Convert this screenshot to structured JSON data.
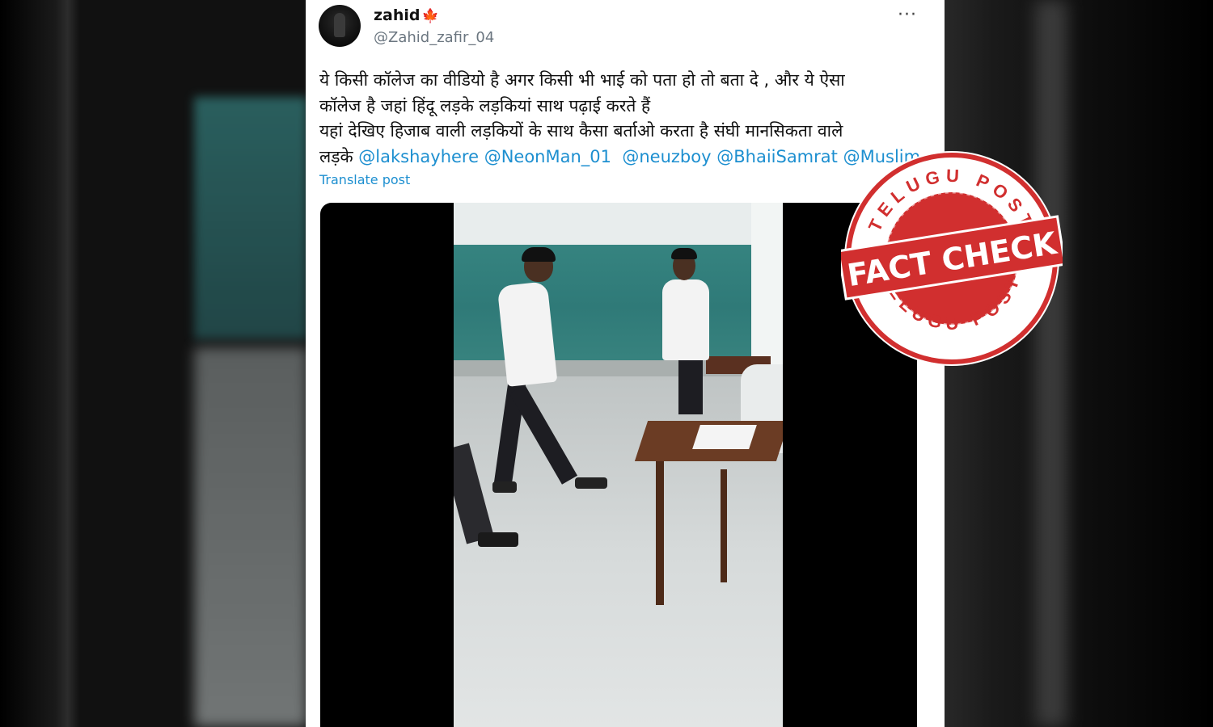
{
  "tweet": {
    "display_name": "zahid",
    "name_emoji": "🍁",
    "handle": "@Zahid_zafir_04",
    "more_label": "···",
    "text_line1": "ये किसी कॉलेज का वीडियो है अगर किसी भी भाई को पता हो तो बता दे , और ये ऐसा",
    "text_line2": "कॉलेज है जहां हिंदू लड़के लड़कियां साथ पढ़ाई करते हैं",
    "text_line3": "यहां देखिए हिजाब वाली लड़कियों के साथ कैसा बर्ताओ करता है संघी मानसिकता वाले",
    "text_line4_prefix": "लड़के ",
    "mentions": [
      "@lakshayhere",
      "@NeonMan_01",
      "@neuzboy",
      "@BhaiiSamrat",
      "@Muslim"
    ],
    "translate_label": "Translate post"
  },
  "stamp": {
    "top_text": "TELUGU POST",
    "center_text": "FACT CHECK",
    "bottom_text": "TELUGU POST",
    "color": "#d12f2f"
  },
  "colors": {
    "mention": "#1d8fd0",
    "handle": "#6b7680",
    "background": "#0d0d0d"
  }
}
